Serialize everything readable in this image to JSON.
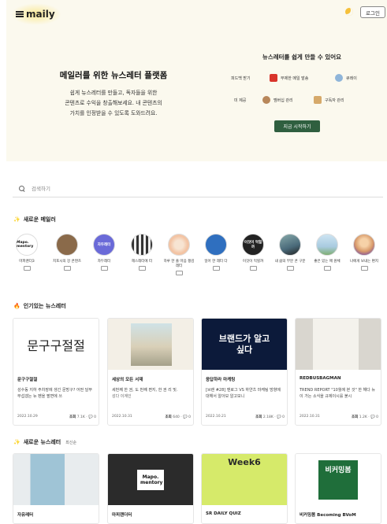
{
  "header": {
    "logo_text": "maily",
    "login_label": "로그인"
  },
  "hero": {
    "title": "메일러를 위한 뉴스레터 플랫폼",
    "desc_lines": [
      "쉽게 뉴스레터를 만들고, 독자들을 위한",
      "콘텐츠로 수익을 창출해보세요. 내 콘텐츠의",
      "가치를 인정받을 수 있도록 도와드려요."
    ],
    "features_title": "뉴스레터를 쉽게 만들 수 있어요",
    "features": [
      "피드백 받기",
      "무제한 메일 발송",
      "큐레이",
      "미 제공",
      "멤버십 관리",
      "구독자 관리"
    ],
    "cta_label": "지금 시작하기"
  },
  "search": {
    "placeholder": "검색하기"
  },
  "sections": {
    "new_mailers": "새로운 메일러",
    "popular": "인기있는 뉴스레터",
    "new_newsletters": "새로운 뉴스레터",
    "new_newsletters_sub": "최신순"
  },
  "mailers": [
    {
      "name": "마피랜더3",
      "avatar_text": "Mapo. mentory",
      "color": "#ffffff"
    },
    {
      "name": "지포시의 강 콘텐츠",
      "avatar_text": "",
      "color": "#8a6a4a"
    },
    {
      "name": "자두레터",
      "avatar_text": "자두레터",
      "color": "#6a6ad8"
    },
    {
      "name": "헤스레터에 터",
      "avatar_text": "",
      "color": "#555555"
    },
    {
      "name": "하루 한 줄 마음 챙김레터",
      "avatar_text": "",
      "color": "#f3d9c4"
    },
    {
      "name": "일어 한 레터 다",
      "avatar_text": "",
      "color": "#2f6fbf"
    },
    {
      "name": "이것이 먹힐까",
      "avatar_text": "이것이 먹힐까",
      "color": "#222222"
    },
    {
      "name": "내 삶의 부분 콘 구분",
      "avatar_text": "",
      "color": "#4a6a7a"
    },
    {
      "name": "좋은 있는 매 원체",
      "avatar_text": "",
      "color": "#a9cbe0"
    },
    {
      "name": "나에게 보내는 편지",
      "avatar_text": "",
      "color": "#d89a6a"
    }
  ],
  "popular_cards": [
    {
      "title": "문구구절절",
      "desc": "성수동 지하 주차장에 생긴 문방구? 어떤 달부 무섭겠는 뉴 펜을 팔면에 쓰",
      "date": "2022.10.29",
      "views": "7.1K",
      "comments": "0",
      "thumb_text": "문구구절절",
      "thumb_bg": "#ffffff"
    },
    {
      "title": "세상의 모든 서재",
      "desc": "세번째 한 권, 도 번째 편지, 한 권 리 및.",
      "author": "성다 이계인",
      "date": "2022.10.31",
      "views": "640",
      "comments": "0",
      "thumb_text": "",
      "thumb_bg": "#f3efe6"
    },
    {
      "title": "응답하라 마케팅",
      "desc": "[브랜 #28] 맨로그 VS 하얀츠 마케팅 방향에 대해서 알아보 알고보니",
      "date": "2022.10.21",
      "views": "2.18K",
      "comments": "0",
      "thumb_text": "브랜드가 알고 싶다",
      "thumb_bg": "#0c1a3a"
    },
    {
      "title": "REDBUSBAGMAN",
      "desc": "TREND REPORT \"10월에 본 것\" 한 해다 뉴 이 가는 소식을 규제이시를 붙시",
      "date": "2022.10.31",
      "views": "1.2K",
      "comments": "0",
      "thumb_text": "",
      "thumb_bg": "#d9d6cf"
    }
  ],
  "new_cards": [
    {
      "title": "자유레터",
      "thumb_bg": "#c9d8de"
    },
    {
      "title": "마피랜더터",
      "thumb_bg": "#2b2b2b",
      "thumb_text": "Mapo. mentory"
    },
    {
      "title": "SR DAILY QUIZ",
      "thumb_bg": "#d6ea6a",
      "thumb_text": "Week6"
    },
    {
      "title": "비커밍봄 Becoming BVoM",
      "thumb_bg": "#ffffff",
      "thumb_text": "비커밍봄 Becoming BVoM"
    }
  ],
  "labels": {
    "views_label": "조회"
  }
}
